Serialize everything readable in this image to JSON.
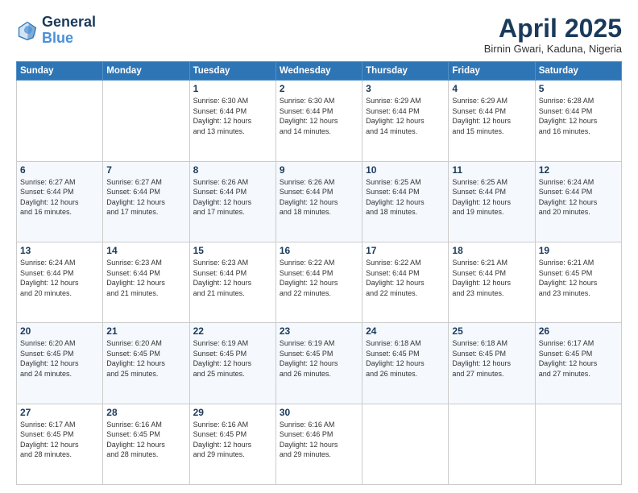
{
  "logo": {
    "line1": "General",
    "line2": "Blue"
  },
  "title": "April 2025",
  "subtitle": "Birnin Gwari, Kaduna, Nigeria",
  "days_of_week": [
    "Sunday",
    "Monday",
    "Tuesday",
    "Wednesday",
    "Thursday",
    "Friday",
    "Saturday"
  ],
  "weeks": [
    [
      {
        "day": "",
        "info": ""
      },
      {
        "day": "",
        "info": ""
      },
      {
        "day": "1",
        "info": "Sunrise: 6:30 AM\nSunset: 6:44 PM\nDaylight: 12 hours\nand 13 minutes."
      },
      {
        "day": "2",
        "info": "Sunrise: 6:30 AM\nSunset: 6:44 PM\nDaylight: 12 hours\nand 14 minutes."
      },
      {
        "day": "3",
        "info": "Sunrise: 6:29 AM\nSunset: 6:44 PM\nDaylight: 12 hours\nand 14 minutes."
      },
      {
        "day": "4",
        "info": "Sunrise: 6:29 AM\nSunset: 6:44 PM\nDaylight: 12 hours\nand 15 minutes."
      },
      {
        "day": "5",
        "info": "Sunrise: 6:28 AM\nSunset: 6:44 PM\nDaylight: 12 hours\nand 16 minutes."
      }
    ],
    [
      {
        "day": "6",
        "info": "Sunrise: 6:27 AM\nSunset: 6:44 PM\nDaylight: 12 hours\nand 16 minutes."
      },
      {
        "day": "7",
        "info": "Sunrise: 6:27 AM\nSunset: 6:44 PM\nDaylight: 12 hours\nand 17 minutes."
      },
      {
        "day": "8",
        "info": "Sunrise: 6:26 AM\nSunset: 6:44 PM\nDaylight: 12 hours\nand 17 minutes."
      },
      {
        "day": "9",
        "info": "Sunrise: 6:26 AM\nSunset: 6:44 PM\nDaylight: 12 hours\nand 18 minutes."
      },
      {
        "day": "10",
        "info": "Sunrise: 6:25 AM\nSunset: 6:44 PM\nDaylight: 12 hours\nand 18 minutes."
      },
      {
        "day": "11",
        "info": "Sunrise: 6:25 AM\nSunset: 6:44 PM\nDaylight: 12 hours\nand 19 minutes."
      },
      {
        "day": "12",
        "info": "Sunrise: 6:24 AM\nSunset: 6:44 PM\nDaylight: 12 hours\nand 20 minutes."
      }
    ],
    [
      {
        "day": "13",
        "info": "Sunrise: 6:24 AM\nSunset: 6:44 PM\nDaylight: 12 hours\nand 20 minutes."
      },
      {
        "day": "14",
        "info": "Sunrise: 6:23 AM\nSunset: 6:44 PM\nDaylight: 12 hours\nand 21 minutes."
      },
      {
        "day": "15",
        "info": "Sunrise: 6:23 AM\nSunset: 6:44 PM\nDaylight: 12 hours\nand 21 minutes."
      },
      {
        "day": "16",
        "info": "Sunrise: 6:22 AM\nSunset: 6:44 PM\nDaylight: 12 hours\nand 22 minutes."
      },
      {
        "day": "17",
        "info": "Sunrise: 6:22 AM\nSunset: 6:44 PM\nDaylight: 12 hours\nand 22 minutes."
      },
      {
        "day": "18",
        "info": "Sunrise: 6:21 AM\nSunset: 6:44 PM\nDaylight: 12 hours\nand 23 minutes."
      },
      {
        "day": "19",
        "info": "Sunrise: 6:21 AM\nSunset: 6:45 PM\nDaylight: 12 hours\nand 23 minutes."
      }
    ],
    [
      {
        "day": "20",
        "info": "Sunrise: 6:20 AM\nSunset: 6:45 PM\nDaylight: 12 hours\nand 24 minutes."
      },
      {
        "day": "21",
        "info": "Sunrise: 6:20 AM\nSunset: 6:45 PM\nDaylight: 12 hours\nand 25 minutes."
      },
      {
        "day": "22",
        "info": "Sunrise: 6:19 AM\nSunset: 6:45 PM\nDaylight: 12 hours\nand 25 minutes."
      },
      {
        "day": "23",
        "info": "Sunrise: 6:19 AM\nSunset: 6:45 PM\nDaylight: 12 hours\nand 26 minutes."
      },
      {
        "day": "24",
        "info": "Sunrise: 6:18 AM\nSunset: 6:45 PM\nDaylight: 12 hours\nand 26 minutes."
      },
      {
        "day": "25",
        "info": "Sunrise: 6:18 AM\nSunset: 6:45 PM\nDaylight: 12 hours\nand 27 minutes."
      },
      {
        "day": "26",
        "info": "Sunrise: 6:17 AM\nSunset: 6:45 PM\nDaylight: 12 hours\nand 27 minutes."
      }
    ],
    [
      {
        "day": "27",
        "info": "Sunrise: 6:17 AM\nSunset: 6:45 PM\nDaylight: 12 hours\nand 28 minutes."
      },
      {
        "day": "28",
        "info": "Sunrise: 6:16 AM\nSunset: 6:45 PM\nDaylight: 12 hours\nand 28 minutes."
      },
      {
        "day": "29",
        "info": "Sunrise: 6:16 AM\nSunset: 6:45 PM\nDaylight: 12 hours\nand 29 minutes."
      },
      {
        "day": "30",
        "info": "Sunrise: 6:16 AM\nSunset: 6:46 PM\nDaylight: 12 hours\nand 29 minutes."
      },
      {
        "day": "",
        "info": ""
      },
      {
        "day": "",
        "info": ""
      },
      {
        "day": "",
        "info": ""
      }
    ]
  ]
}
